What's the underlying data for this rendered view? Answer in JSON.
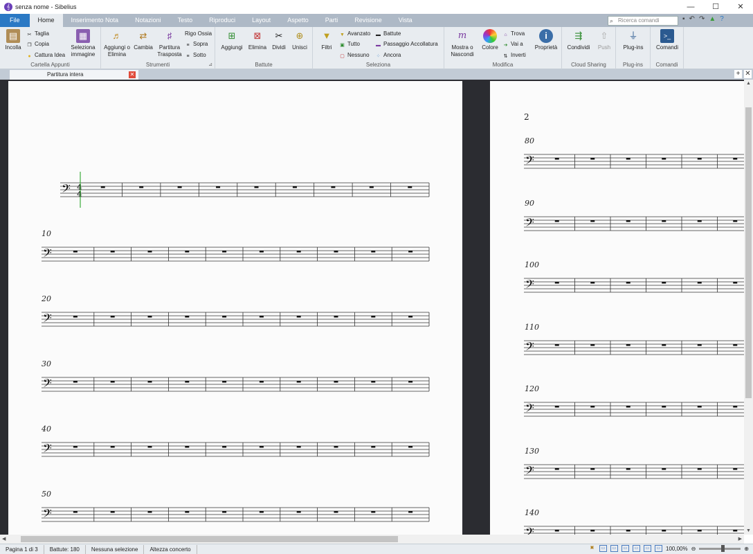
{
  "window": {
    "title": "senza nome - Sibelius",
    "controls": [
      "—",
      "☐",
      "✕"
    ]
  },
  "tabs": [
    {
      "label": "File"
    },
    {
      "label": "Home"
    },
    {
      "label": "Inserimento Nota"
    },
    {
      "label": "Notazioni"
    },
    {
      "label": "Testo"
    },
    {
      "label": "Riproduci"
    },
    {
      "label": "Layout"
    },
    {
      "label": "Aspetto"
    },
    {
      "label": "Parti"
    },
    {
      "label": "Revisione"
    },
    {
      "label": "Vista"
    }
  ],
  "search": {
    "placeholder": "Ricerca comandi"
  },
  "ribbon": {
    "clipboard": {
      "label": "Cartella Appunti",
      "paste": "Incolla",
      "cut": "Taglia",
      "copy": "Copia",
      "capture_idea": "Cattura Idea",
      "select_graphic": "Seleziona immagine"
    },
    "instruments": {
      "label": "Strumenti",
      "add_remove": "Aggiungi o Elimina",
      "change": "Cambia",
      "transposing": "Partitura Trasposta",
      "ossia": "Rigo Ossia",
      "above": "Sopra",
      "below": "Sotto"
    },
    "bars": {
      "label": "Battute",
      "add": "Aggiungi",
      "delete": "Elimina",
      "split": "Dividi",
      "join": "Unisci"
    },
    "select": {
      "label": "Seleziona",
      "filters": "Filtri",
      "advanced": "Avanzato",
      "all": "Tutto",
      "none": "Nessuno",
      "bars": "Battute",
      "system_passage": "Passaggio Accollatura",
      "more": "Ancora"
    },
    "edit": {
      "label": "Modifica",
      "show_hide": "Mostra o Nascondi",
      "color": "Colore",
      "find": "Trova",
      "goto": "Vai a",
      "invert": "Inverti",
      "properties": "Proprietà"
    },
    "cloud": {
      "label": "Cloud Sharing",
      "share": "Condividi",
      "push": "Push"
    },
    "plugins": {
      "label": "Plug-ins",
      "plugins": "Plug-ins"
    },
    "commands": {
      "label": "Comandi",
      "commands": "Comandi"
    }
  },
  "document": {
    "tab_label": "Partitura intera"
  },
  "score": {
    "page2_number": "2",
    "page1_systems": [
      {
        "bar": ""
      },
      {
        "bar": "10"
      },
      {
        "bar": "20"
      },
      {
        "bar": "30"
      },
      {
        "bar": "40"
      },
      {
        "bar": "50"
      }
    ],
    "page2_systems": [
      {
        "bar": "80"
      },
      {
        "bar": "90"
      },
      {
        "bar": "100"
      },
      {
        "bar": "110"
      },
      {
        "bar": "120"
      },
      {
        "bar": "130"
      },
      {
        "bar": "140"
      }
    ],
    "time_signature": {
      "top": "4",
      "bottom": "4"
    }
  },
  "status": {
    "page": "Pagina 1 di 3",
    "bars": "Battute: 180",
    "selection": "Nessuna selezione",
    "pitch": "Altezza concerto",
    "zoom": "100,00%"
  },
  "colors": {
    "accent": "#2b79c4",
    "tabbar": "#aeb9c6",
    "ribbon": "#e8ecf0",
    "workspace": "#2b2c31",
    "cursor": "#3cae3c"
  }
}
